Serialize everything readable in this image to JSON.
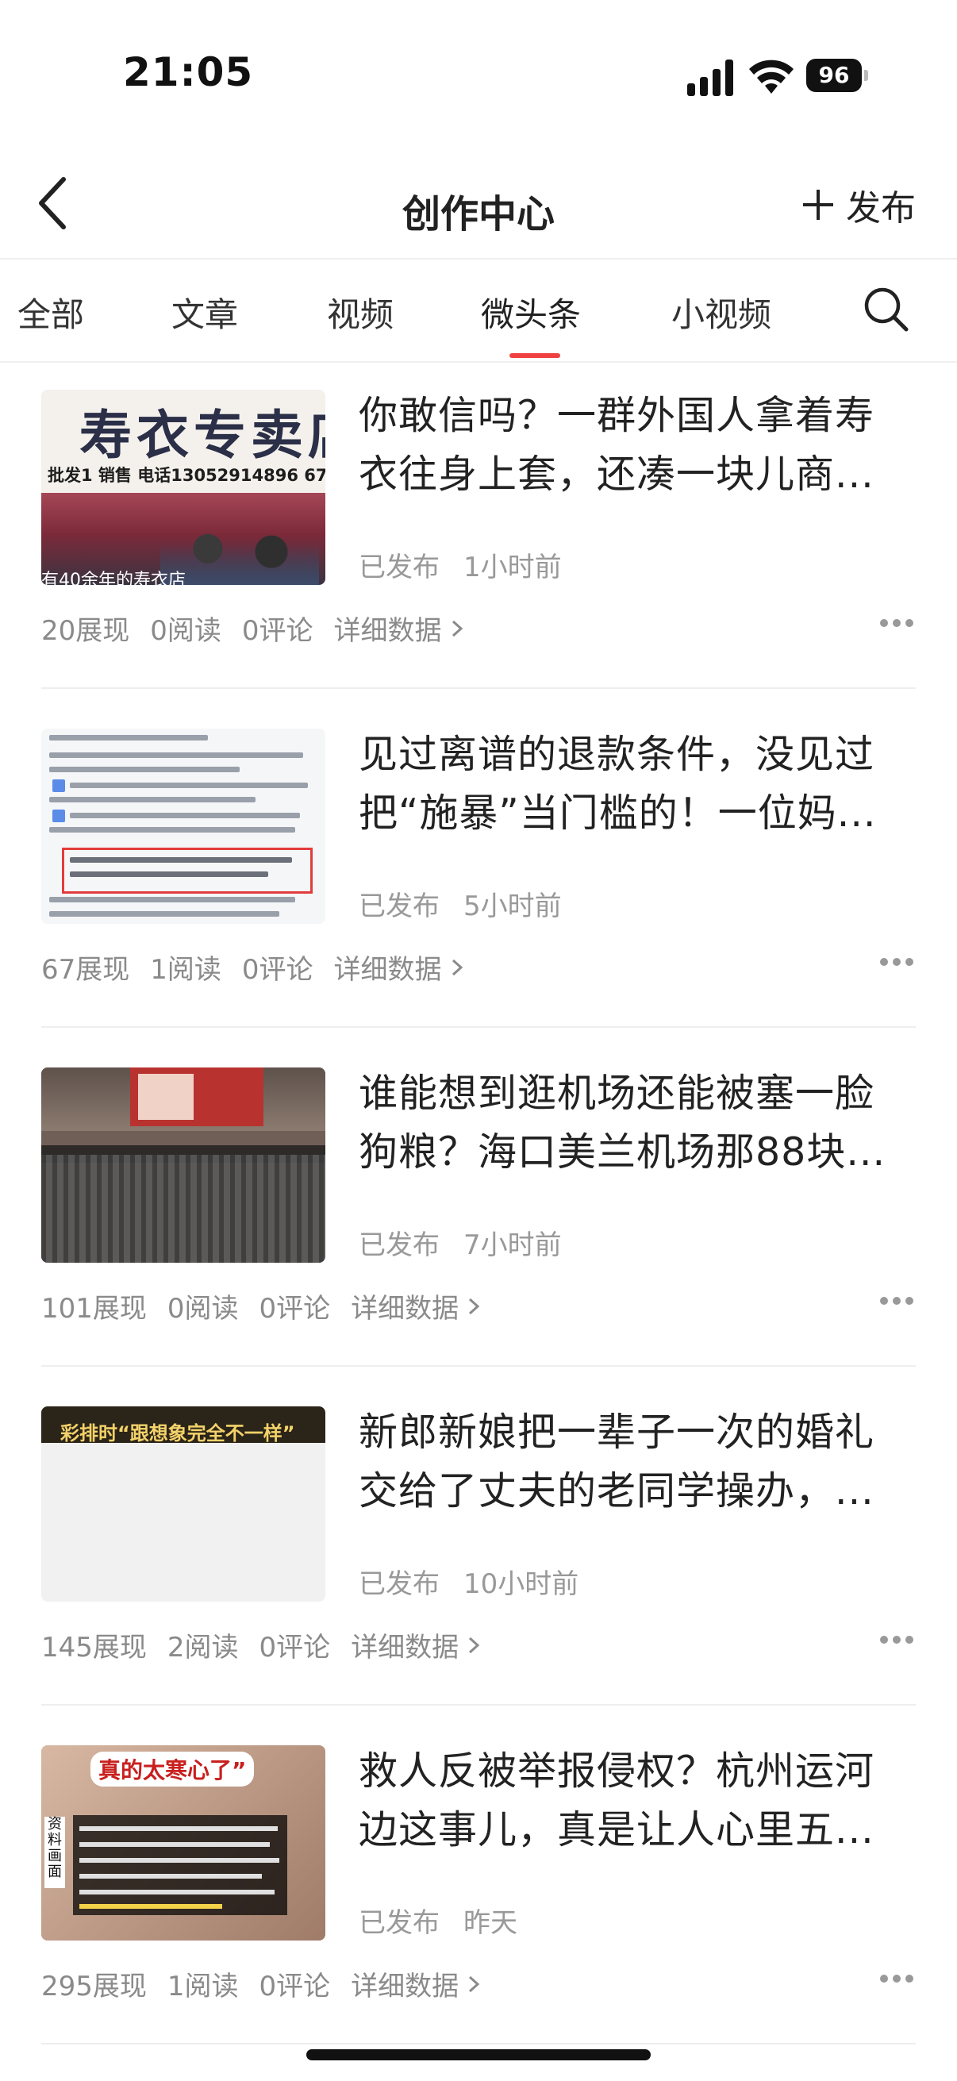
{
  "status_bar": {
    "time": "21:05",
    "battery": "96"
  },
  "nav": {
    "title": "创作中心",
    "publish_label": "发布"
  },
  "tabs": [
    {
      "label": "全部"
    },
    {
      "label": "文章"
    },
    {
      "label": "视频"
    },
    {
      "label": "微头条",
      "active": true
    },
    {
      "label": "小视频"
    }
  ],
  "posts": [
    {
      "title_lines": [
        "你敢信吗？一群外国人拿着寿",
        "衣往身上套，还凑一块儿商..."
      ],
      "status": "已发布",
      "time": "1小时前",
      "impressions": "20展现",
      "reads": "0阅读",
      "comments": "0评论",
      "detail": "详细数据",
      "thumb_text": {
        "big": "寿衣专卖店",
        "small": "批发1 销售 电话13052914896 67",
        "sub": "有40余年的寿衣店"
      }
    },
    {
      "title_lines": [
        "见过离谱的退款条件，没见过",
        "把“施暴”当门槛的！一位妈..."
      ],
      "status": "已发布",
      "time": "5小时前",
      "impressions": "67展现",
      "reads": "1阅读",
      "comments": "0评论",
      "detail": "详细数据"
    },
    {
      "title_lines": [
        "谁能想到逛机场还能被塞一脸",
        "狗粮？海口美兰机场那88块..."
      ],
      "status": "已发布",
      "time": "7小时前",
      "impressions": "101展现",
      "reads": "0阅读",
      "comments": "0评论",
      "detail": "详细数据"
    },
    {
      "title_lines": [
        "新郎新娘把一辈子一次的婚礼",
        "交给了丈夫的老同学操办，..."
      ],
      "status": "已发布",
      "time": "10小时前",
      "impressions": "145展现",
      "reads": "2阅读",
      "comments": "0评论",
      "detail": "详细数据",
      "thumb_text": {
        "banner": "彩排时“跟想象完全不一样”"
      }
    },
    {
      "title_lines": [
        "救人反被举报侵权？杭州运河",
        "边这事儿，真是让人心里五..."
      ],
      "status": "已发布",
      "time": "昨天",
      "impressions": "295展现",
      "reads": "1阅读",
      "comments": "0评论",
      "detail": "详细数据",
      "thumb_text": {
        "headline": "真的太寒心了”",
        "side": "资料画面"
      }
    }
  ],
  "colors": {
    "accent": "#f04142",
    "meta": "#999999",
    "text": "#222222"
  }
}
